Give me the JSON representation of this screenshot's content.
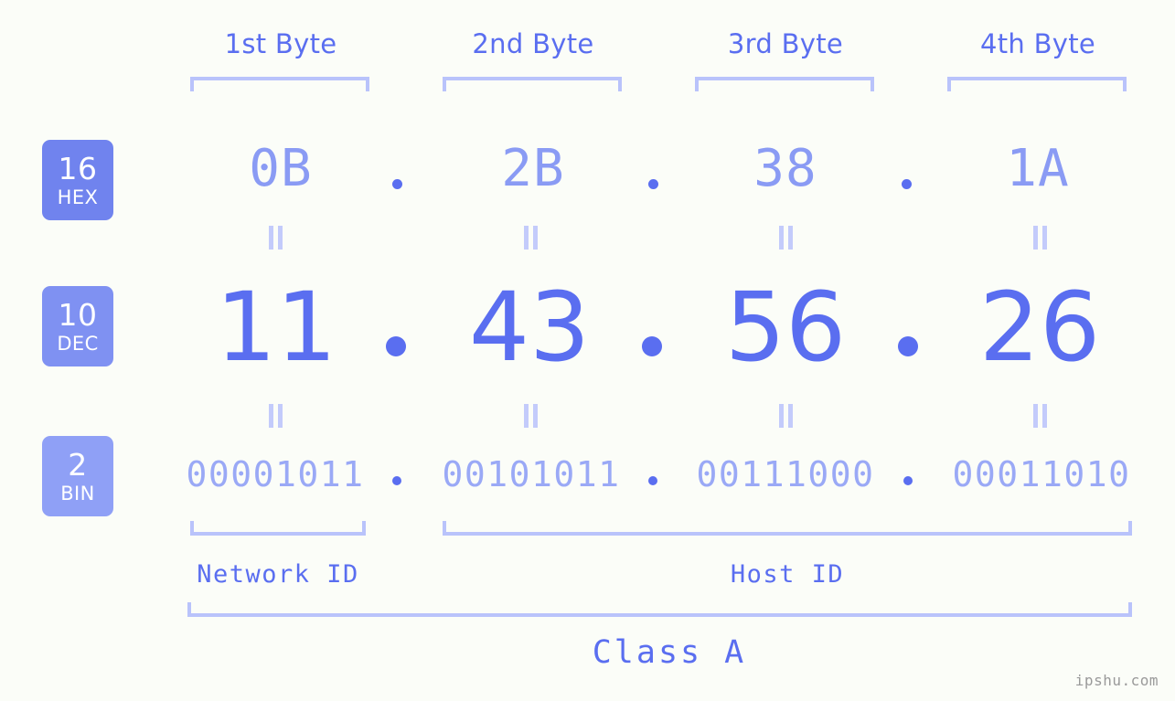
{
  "meta": {
    "background_color": "#fbfdf8",
    "accent_color": "#5a6ef0",
    "light_accent_color": "#b9c3fb",
    "watermark": "ipshu.com"
  },
  "byte_headers": [
    {
      "label": "1st Byte"
    },
    {
      "label": "2nd Byte"
    },
    {
      "label": "3rd Byte"
    },
    {
      "label": "4th Byte"
    }
  ],
  "radix_rows": [
    {
      "badge_number": "16",
      "badge_name": "HEX",
      "badge_color": "#7083ee",
      "values": [
        "0B",
        "2B",
        "38",
        "1A"
      ],
      "separator": "."
    },
    {
      "badge_number": "10",
      "badge_name": "DEC",
      "badge_color": "#7f91f2",
      "values": [
        "11",
        "43",
        "56",
        "26"
      ],
      "separator": "."
    },
    {
      "badge_number": "2",
      "badge_name": "BIN",
      "badge_color": "#8fa0f6",
      "values": [
        "00001011",
        "00101011",
        "00111000",
        "00011010"
      ],
      "separator": "."
    }
  ],
  "equality_marks": {
    "symbol": "=",
    "count_per_row": 4,
    "rows": 2
  },
  "sections": [
    {
      "label": "Network ID"
    },
    {
      "label": "Host ID"
    }
  ],
  "class": {
    "label": "Class A"
  }
}
